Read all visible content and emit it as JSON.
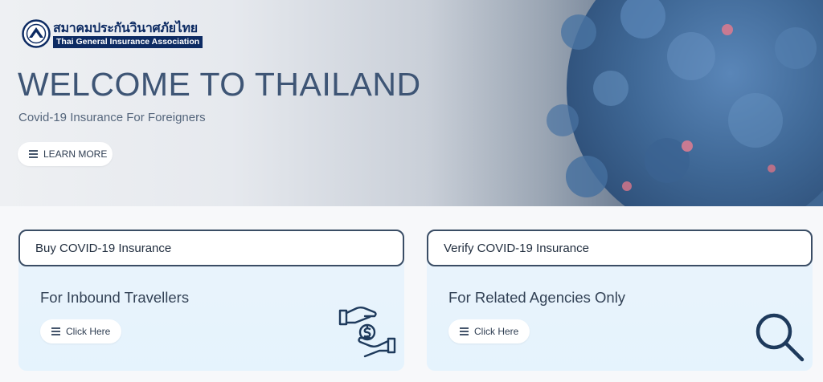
{
  "logo": {
    "thai_name": "สมาคมประกันวินาศภัยไทย",
    "english_name": "Thai General Insurance Association"
  },
  "hero": {
    "title": "WELCOME TO THAILAND",
    "subtitle": "Covid-19 Insurance For Foreigners",
    "learn_more": "LEARN MORE"
  },
  "cards": [
    {
      "title": "Buy COVID-19 Insurance",
      "description": "For Inbound Travellers",
      "button": "Click Here",
      "icon": "money-exchange-icon"
    },
    {
      "title": "Verify COVID-19 Insurance",
      "description": "For Related Agencies Only",
      "button": "Click Here",
      "icon": "magnifier-icon"
    }
  ],
  "colors": {
    "navy": "#0d2b63",
    "title_text": "#3e5575",
    "card_border": "#3a4d65",
    "icon": "#1e3a5c"
  }
}
